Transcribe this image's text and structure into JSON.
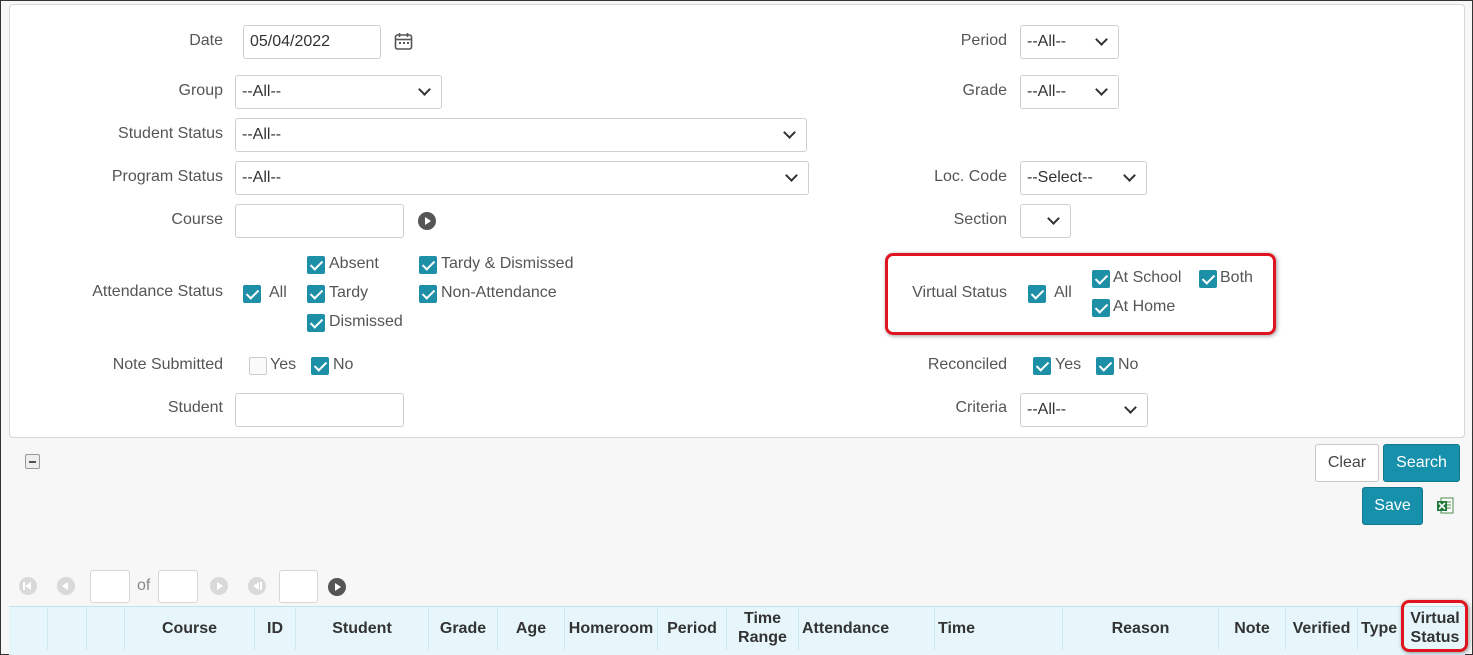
{
  "filters": {
    "date_label": "Date",
    "date_value": "05/04/2022",
    "group_label": "Group",
    "group_value": "--All--",
    "student_status_label": "Student Status",
    "student_status_value": "--All--",
    "program_status_label": "Program Status",
    "program_status_value": "--All--",
    "course_label": "Course",
    "course_value": "",
    "attendance_status_label": "Attendance Status",
    "attendance": {
      "all": "All",
      "absent": "Absent",
      "tardy": "Tardy",
      "dismissed": "Dismissed",
      "tardy_dismissed": "Tardy & Dismissed",
      "non_attendance": "Non-Attendance"
    },
    "note_submitted_label": "Note Submitted",
    "note_yes": "Yes",
    "note_no": "No",
    "student_label": "Student",
    "student_value": "",
    "period_label": "Period",
    "period_value": "--All--",
    "grade_label": "Grade",
    "grade_value": "--All--",
    "loc_code_label": "Loc. Code",
    "loc_code_value": "--Select--",
    "section_label": "Section",
    "section_value": "",
    "virtual_status_label": "Virtual Status",
    "virtual": {
      "all": "All",
      "at_school": "At School",
      "both": "Both",
      "at_home": "At Home"
    },
    "reconciled_label": "Reconciled",
    "reconciled_yes": "Yes",
    "reconciled_no": "No",
    "criteria_label": "Criteria",
    "criteria_value": "--All--"
  },
  "actions": {
    "clear": "Clear",
    "search": "Search",
    "save": "Save",
    "export_icon": "excel-icon"
  },
  "pager": {
    "of": "of",
    "page": "",
    "total": "",
    "page_size": ""
  },
  "table": {
    "columns": [
      "Course",
      "ID",
      "Student",
      "Grade",
      "Age",
      "Homeroom",
      "Period",
      "Time Range",
      "Attendance",
      "Time",
      "Reason",
      "Note",
      "Verified",
      "Type",
      "Virtual Status"
    ]
  },
  "colors": {
    "accent": "#1790ab",
    "checkbox": "#1d8fa6",
    "highlight": "#e0141e",
    "header_bg": "#e6f6fb"
  }
}
